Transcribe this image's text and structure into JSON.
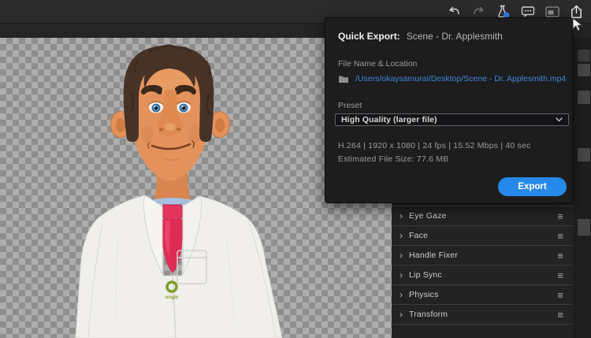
{
  "toolbar": {
    "icons": [
      "undo",
      "redo",
      "test-flask",
      "comments",
      "panel",
      "share-export"
    ]
  },
  "quick_export": {
    "title": "Quick Export:",
    "scene_name": "Scene - Dr. Applesmith",
    "file_section_label": "File Name & Location",
    "file_path": "/Users/okaysamurai/Desktop/Scene - Dr. Applesmith.mp4",
    "preset_label": "Preset",
    "preset_value": "High Quality (larger file)",
    "info_line": "H.264 | 1920 x 1080 | 24 fps | 15.52 Mbps | 40 sec",
    "estimated_size": "Estimated File Size: 77.6 MB",
    "export_button_label": "Export",
    "accent_color": "#2688e8",
    "link_color": "#3f86d6"
  },
  "properties_panel": {
    "rows": [
      {
        "label": "Eye Gaze"
      },
      {
        "label": "Face"
      },
      {
        "label": "Handle Fixer"
      },
      {
        "label": "Lip Sync"
      },
      {
        "label": "Physics"
      },
      {
        "label": "Transform"
      }
    ]
  },
  "character": {
    "badge_text": "origin"
  }
}
